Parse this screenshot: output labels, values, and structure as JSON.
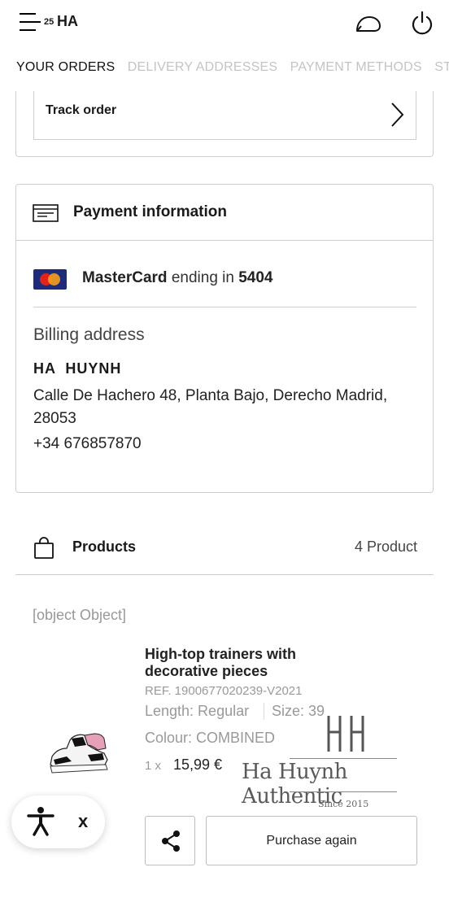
{
  "header": {
    "cart_count": "25",
    "user_initials": "HA",
    "menu_icon": "menu-icon",
    "chat_icon": "chat-icon",
    "logout_icon": "power-icon"
  },
  "tabs": [
    {
      "label": "YOUR ORDERS",
      "active": true
    },
    {
      "label": "DELIVERY ADDRESSES",
      "active": false
    },
    {
      "label": "PAYMENT METHODS",
      "active": false
    },
    {
      "label": "STORE PURCHASES",
      "active": false
    }
  ],
  "track": {
    "label": "Track order"
  },
  "payment": {
    "title": "Payment information",
    "card_brand": "MasterCard",
    "ending_text": "ending in",
    "last4": "5404",
    "billing_title": "Billing address",
    "name": "HA  HUYNH",
    "address": "Calle De Hachero 48, Planta Bajo, Derecho Madrid, 28053",
    "phone": "+34 676857870"
  },
  "products": {
    "title": "Products",
    "count": "4 Product",
    "placeholder": "[object Object]",
    "item": {
      "name": "High-top trainers with decorative pieces",
      "ref": "REF. 1900677020239-V2021",
      "length": "Length: Regular",
      "size": "Size: 39",
      "colour": "Colour: COMBINED",
      "qty": "1 x",
      "price": "15,99 €"
    },
    "purchase_again": "Purchase again"
  },
  "watermark": {
    "brand": "Ha Huynh Authentic",
    "since": "Since 2015"
  },
  "accessibility": {
    "close": "x"
  },
  "colors": {
    "border": "#cfcfcf",
    "muted_text": "#999999",
    "inactive_tab": "#c4c4c4",
    "mastercard_bg": "#1c2c7a"
  }
}
